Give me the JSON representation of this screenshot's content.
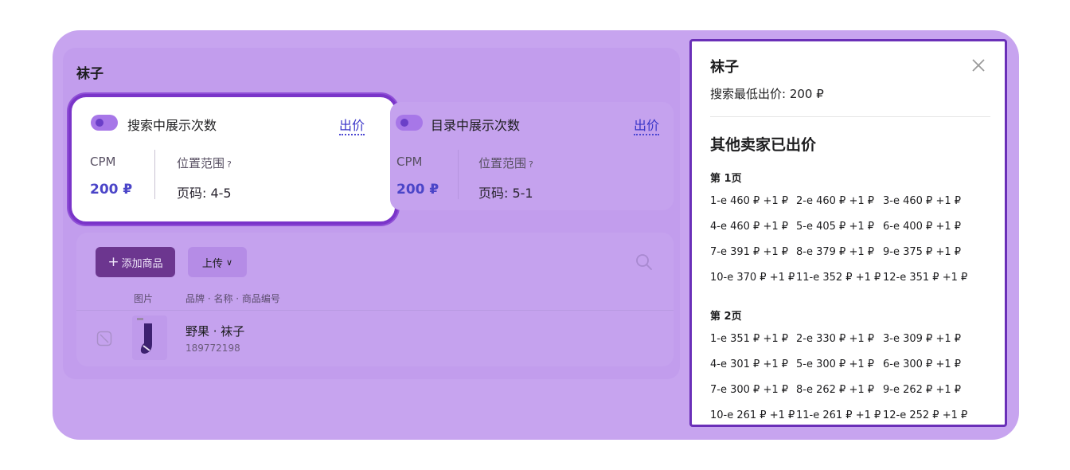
{
  "campaign_title": "袜子",
  "search": {
    "heading": "搜索中展示次数",
    "bid_link": "出价",
    "cpm_label": "CPM",
    "cpm_value": "200 ₽",
    "range_label": "位置范围",
    "range_hint": "?",
    "pages": "页码: 4-5"
  },
  "catalog": {
    "heading": "目录中展示次数",
    "bid_link": "出价",
    "cpm_label": "CPM",
    "cpm_value": "200 ₽",
    "range_label": "位置范围",
    "range_hint": "?",
    "pages": "页码: 5-1"
  },
  "products": {
    "add_button": "添加商品",
    "add_icon": "+",
    "upload_button": "上传",
    "upload_chevron": "∨",
    "col_image": "图片",
    "col_info": "品牌 · 名称 · 商品编号",
    "row": {
      "name": "野果 · 袜子",
      "id": "189772198"
    }
  },
  "sidebar": {
    "title": "袜子",
    "min_bid": "搜索最低出价: 200 ₽",
    "other_bids_title": "其他卖家已出价",
    "pages": [
      {
        "label": "第 1页",
        "bids": [
          "1-e  460 ₽ +1 ₽",
          "2-e  460 ₽ +1 ₽",
          "3-e  460 ₽ +1 ₽",
          "4-e  460 ₽ +1 ₽",
          "5-e  405 ₽ +1 ₽",
          "6-e  400 ₽ +1 ₽",
          "7-e  391 ₽ +1 ₽",
          "8-e  379 ₽ +1 ₽",
          "9-e  375 ₽ +1 ₽",
          "10-e  370 ₽ +1 ₽",
          "11-e  352 ₽ +1 ₽",
          "12-e  351 ₽ +1 ₽"
        ]
      },
      {
        "label": "第 2页",
        "bids": [
          "1-e  351 ₽ +1 ₽",
          "2-e  330 ₽ +1 ₽",
          "3-e  309 ₽ +1 ₽",
          "4-e  301 ₽ +1 ₽",
          "5-e  300 ₽ +1 ₽",
          "6-e  300 ₽ +1 ₽",
          "7-e  300 ₽ +1 ₽",
          "8-e  262 ₽ +1 ₽",
          "9-e  262 ₽ +1 ₽",
          "10-e  261 ₽ +1 ₽",
          "11-e  261 ₽ +1 ₽",
          "12-e  252 ₽ +1 ₽"
        ]
      }
    ]
  },
  "colors": {
    "frame": "#c7a4ef",
    "accent_border": "#6a2fb8",
    "link": "#3b36c9",
    "add_button": "#6c368f"
  }
}
